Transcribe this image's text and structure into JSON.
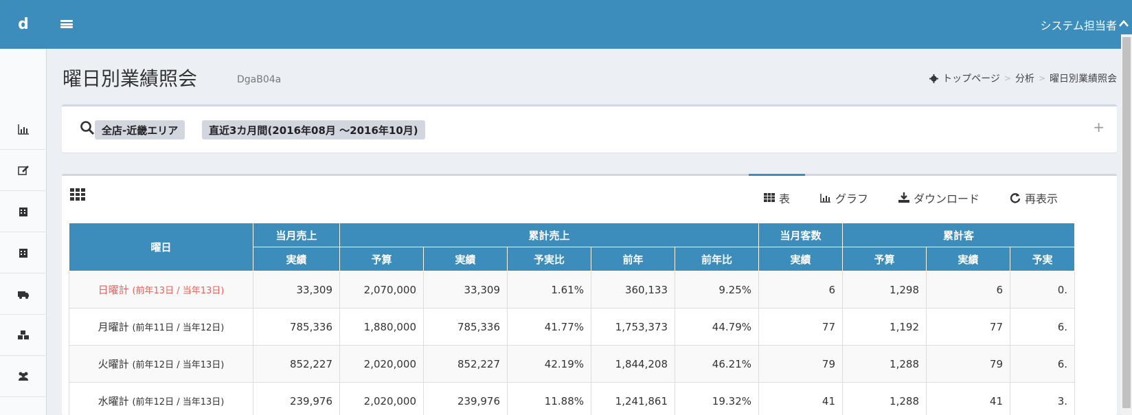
{
  "header": {
    "logo": "d",
    "user_name": "システム担当者"
  },
  "page": {
    "title": "曜日別業績照会",
    "subtitle": "DgaB04a",
    "breadcrumb": [
      "トップページ",
      "分析",
      "曜日別業績照会"
    ]
  },
  "search": {
    "tags": [
      "全店-近畿エリア",
      "直近3カ月間(2016年08月 ～2016年10月)"
    ],
    "expand_label": "+"
  },
  "tabs": [
    {
      "label": "表",
      "icon": "table-icon"
    },
    {
      "label": "グラフ",
      "icon": "bar-chart-icon"
    },
    {
      "label": "ダウンロード",
      "icon": "download-icon"
    },
    {
      "label": "再表示",
      "icon": "refresh-icon"
    }
  ],
  "table": {
    "group_headers": {
      "day": "曜日",
      "monthly_sales": "当月売上",
      "cumulative_sales": "累計売上",
      "monthly_customers": "当月客数",
      "cumulative_customers": "累計客"
    },
    "sub_headers": [
      "実績",
      "予算",
      "実績",
      "予実比",
      "前年",
      "前年比",
      "実績",
      "予算",
      "実績",
      "予実"
    ],
    "rows": [
      {
        "day": "日曜計",
        "detail": "(前年13日 / 当年13日)",
        "cells": [
          "33,309",
          "2,070,000",
          "33,309",
          "1.61%",
          "360,133",
          "9.25%",
          "6",
          "1,298",
          "6",
          "0."
        ]
      },
      {
        "day": "月曜計",
        "detail": "(前年11日 / 当年12日)",
        "cells": [
          "785,336",
          "1,880,000",
          "785,336",
          "41.77%",
          "1,753,373",
          "44.79%",
          "77",
          "1,192",
          "77",
          "6."
        ]
      },
      {
        "day": "火曜計",
        "detail": "(前年12日 / 当年13日)",
        "cells": [
          "852,227",
          "2,020,000",
          "852,227",
          "42.19%",
          "1,844,208",
          "46.21%",
          "79",
          "1,288",
          "79",
          "6."
        ]
      },
      {
        "day": "水曜計",
        "detail": "(前年12日 / 当年13日)",
        "cells": [
          "239,976",
          "2,020,000",
          "239,976",
          "11.88%",
          "1,241,861",
          "19.32%",
          "41",
          "1,288",
          "41",
          "3."
        ]
      }
    ]
  },
  "colors": {
    "primary": "#3c8dbc",
    "sunday": "#e8615a"
  }
}
